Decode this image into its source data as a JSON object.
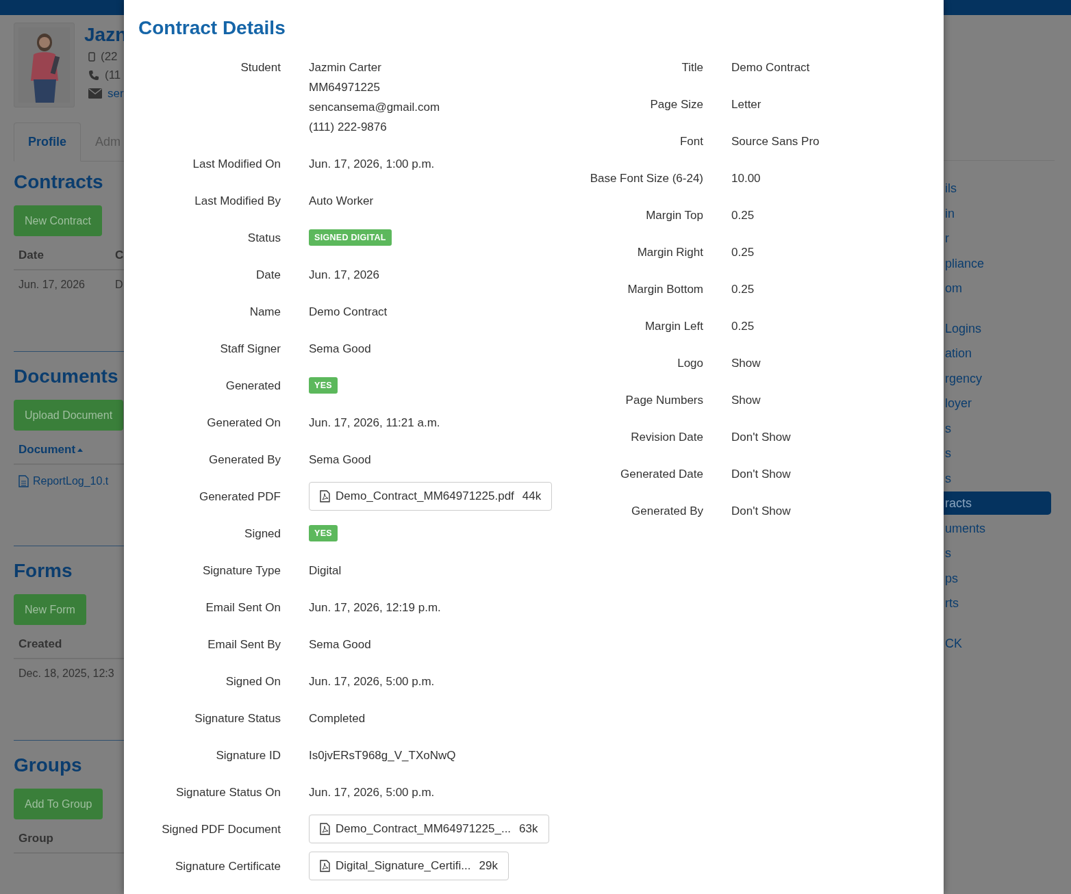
{
  "background": {
    "profile": {
      "name": "Jazn",
      "contacts": [
        {
          "kind": "mobile",
          "text": "(22"
        },
        {
          "kind": "phone",
          "text": "(11"
        },
        {
          "kind": "email",
          "text": "ser"
        }
      ]
    },
    "tabs": [
      {
        "label": "Profile",
        "selected": true
      },
      {
        "label": "Adm",
        "selected": false
      }
    ],
    "sections": [
      {
        "title": "Contracts",
        "button": "New Contract",
        "columns": [
          {
            "label": "Date",
            "sorted": false
          },
          {
            "label": "C",
            "sorted": false
          }
        ],
        "rows": [
          [
            {
              "text": "Jun. 17, 2026",
              "kind": "text"
            },
            {
              "text": "D",
              "kind": "text"
            }
          ]
        ]
      },
      {
        "title": "Documents",
        "button": "Upload Document",
        "columns": [
          {
            "label": "Document",
            "sorted": true
          }
        ],
        "rows": [
          [
            {
              "text": "ReportLog_10.t",
              "kind": "file"
            }
          ]
        ]
      },
      {
        "title": "Forms",
        "button": "New Form",
        "columns": [
          {
            "label": "Created",
            "sorted": false
          }
        ],
        "rows": [
          [
            {
              "text": "Dec. 18, 2025, 12:3",
              "kind": "text"
            }
          ]
        ]
      },
      {
        "title": "Groups",
        "button": "Add To Group",
        "columns": [
          {
            "label": "Group",
            "sorted": false
          }
        ]
      }
    ],
    "nav": [
      [
        {
          "label": "ils",
          "selected": false
        },
        {
          "label": "in",
          "selected": false
        },
        {
          "label": "r",
          "selected": false
        },
        {
          "label": "pliance",
          "selected": false
        },
        {
          "label": "om",
          "selected": false
        }
      ],
      [
        {
          "label": "Logins",
          "selected": false
        },
        {
          "label": "ation",
          "selected": false
        },
        {
          "label": "rgency",
          "selected": false
        },
        {
          "label": "loyer",
          "selected": false
        },
        {
          "label": "s",
          "selected": false
        },
        {
          "label": "s",
          "selected": false
        },
        {
          "label": "s",
          "selected": false
        },
        {
          "label": "racts",
          "selected": true
        },
        {
          "label": "uments",
          "selected": false
        },
        {
          "label": "s",
          "selected": false
        },
        {
          "label": "ps",
          "selected": false
        },
        {
          "label": "rts",
          "selected": false
        }
      ],
      [
        {
          "label": "CK",
          "selected": false
        }
      ]
    ]
  },
  "modal": {
    "title": "Contract Details",
    "left": [
      {
        "label": "Student",
        "kind": "lines",
        "lines": [
          "Jazmin Carter",
          "MM64971225",
          "sencansema@gmail.com",
          "(111) 222-9876"
        ]
      },
      {
        "label": "Last Modified On",
        "kind": "text",
        "value": "Jun. 17, 2026, 1:00 p.m."
      },
      {
        "label": "Last Modified By",
        "kind": "text",
        "value": "Auto Worker"
      },
      {
        "label": "Status",
        "kind": "badge",
        "value": "SIGNED DIGITAL"
      },
      {
        "label": "Date",
        "kind": "text",
        "value": "Jun. 17, 2026"
      },
      {
        "label": "Name",
        "kind": "text",
        "value": "Demo Contract"
      },
      {
        "label": "Staff Signer",
        "kind": "text",
        "value": "Sema Good"
      },
      {
        "label": "Generated",
        "kind": "badge",
        "value": "YES"
      },
      {
        "label": "Generated On",
        "kind": "text",
        "value": "Jun. 17, 2026, 11:21 a.m."
      },
      {
        "label": "Generated By",
        "kind": "text",
        "value": "Sema Good"
      },
      {
        "label": "Generated PDF",
        "kind": "file",
        "value": "Demo_Contract_MM64971225.pdf",
        "size": "44k"
      },
      {
        "label": "Signed",
        "kind": "badge",
        "value": "YES"
      },
      {
        "label": "Signature Type",
        "kind": "text",
        "value": "Digital"
      },
      {
        "label": "Email Sent On",
        "kind": "text",
        "value": "Jun. 17, 2026, 12:19 p.m."
      },
      {
        "label": "Email Sent By",
        "kind": "text",
        "value": "Sema Good"
      },
      {
        "label": "Signed On",
        "kind": "text",
        "value": "Jun. 17, 2026, 5:00 p.m."
      },
      {
        "label": "Signature Status",
        "kind": "text",
        "value": "Completed"
      },
      {
        "label": "Signature ID",
        "kind": "text",
        "value": "Is0jvERsT968g_V_TXoNwQ"
      },
      {
        "label": "Signature Status On",
        "kind": "text",
        "value": "Jun. 17, 2026, 5:00 p.m."
      },
      {
        "label": "Signed PDF Document",
        "kind": "file",
        "value": "Demo_Contract_MM64971225_...",
        "size": "63k"
      },
      {
        "label": "Signature Certificate",
        "kind": "file",
        "value": "Digital_Signature_Certifi...",
        "size": "29k"
      }
    ],
    "right": [
      {
        "label": "Title",
        "kind": "text",
        "value": "Demo Contract"
      },
      {
        "label": "Page Size",
        "kind": "text",
        "value": "Letter"
      },
      {
        "label": "Font",
        "kind": "text",
        "value": "Source Sans Pro"
      },
      {
        "label": "Base Font Size (6-24)",
        "kind": "text",
        "value": "10.00"
      },
      {
        "label": "Margin Top",
        "kind": "text",
        "value": "0.25"
      },
      {
        "label": "Margin Right",
        "kind": "text",
        "value": "0.25"
      },
      {
        "label": "Margin Bottom",
        "kind": "text",
        "value": "0.25"
      },
      {
        "label": "Margin Left",
        "kind": "text",
        "value": "0.25"
      },
      {
        "label": "Logo",
        "kind": "text",
        "value": "Show"
      },
      {
        "label": "Page Numbers",
        "kind": "text",
        "value": "Show"
      },
      {
        "label": "Revision Date",
        "kind": "text",
        "value": "Don't Show"
      },
      {
        "label": "Generated Date",
        "kind": "text",
        "value": "Don't Show"
      },
      {
        "label": "Generated By",
        "kind": "text",
        "value": "Don't Show"
      }
    ]
  }
}
